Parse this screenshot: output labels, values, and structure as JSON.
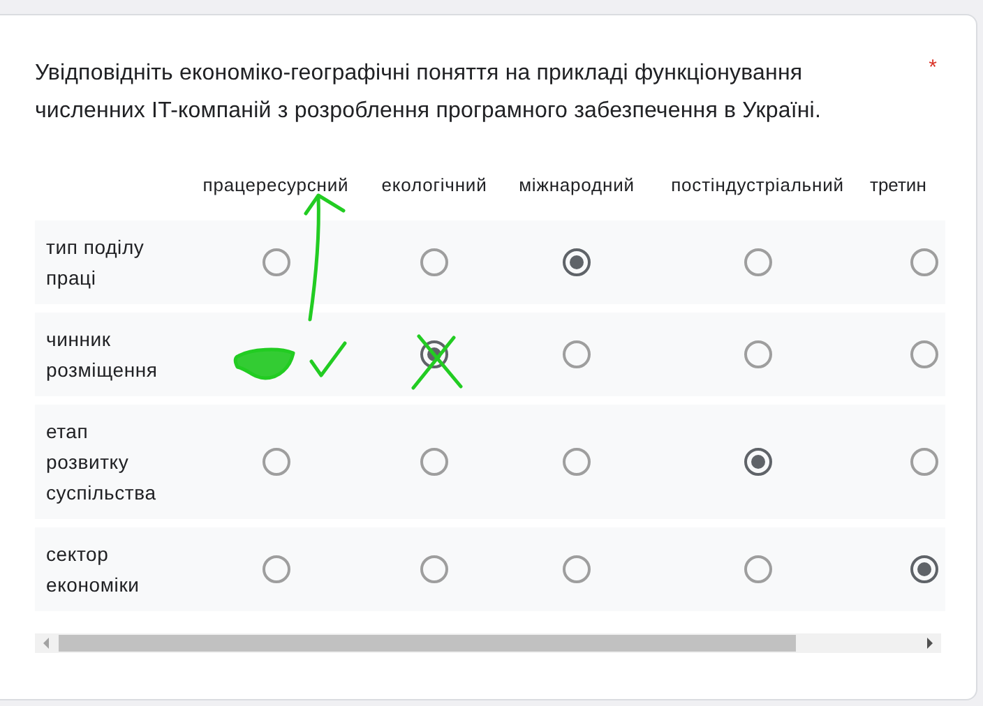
{
  "question": {
    "title": "Увідповідніть економіко-географічні поняття на прикладі функціонування численних IT-компаній з розроблення програмного забезпечення в Україні.",
    "required_mark": "*"
  },
  "columns": [
    "працересурсний",
    "екологічний",
    "міжнародний",
    "постіндустріальний",
    "третин"
  ],
  "rows": [
    {
      "label": "тип поділу праці",
      "options": [
        {
          "selected": false
        },
        {
          "selected": false
        },
        {
          "selected": true
        },
        {
          "selected": false
        },
        {
          "selected": false
        }
      ]
    },
    {
      "label": "чинник розміщення",
      "options": [
        {
          "kind": "covered"
        },
        {
          "selected": true
        },
        {
          "selected": false
        },
        {
          "selected": false
        },
        {
          "selected": false
        }
      ]
    },
    {
      "label": "етап розвитку суспільства",
      "options": [
        {
          "selected": false
        },
        {
          "selected": false
        },
        {
          "selected": false
        },
        {
          "selected": true
        },
        {
          "selected": false
        }
      ]
    },
    {
      "label": "сектор економіки",
      "options": [
        {
          "selected": false
        },
        {
          "selected": false
        },
        {
          "selected": false
        },
        {
          "selected": false
        },
        {
          "selected": true
        }
      ]
    }
  ]
}
